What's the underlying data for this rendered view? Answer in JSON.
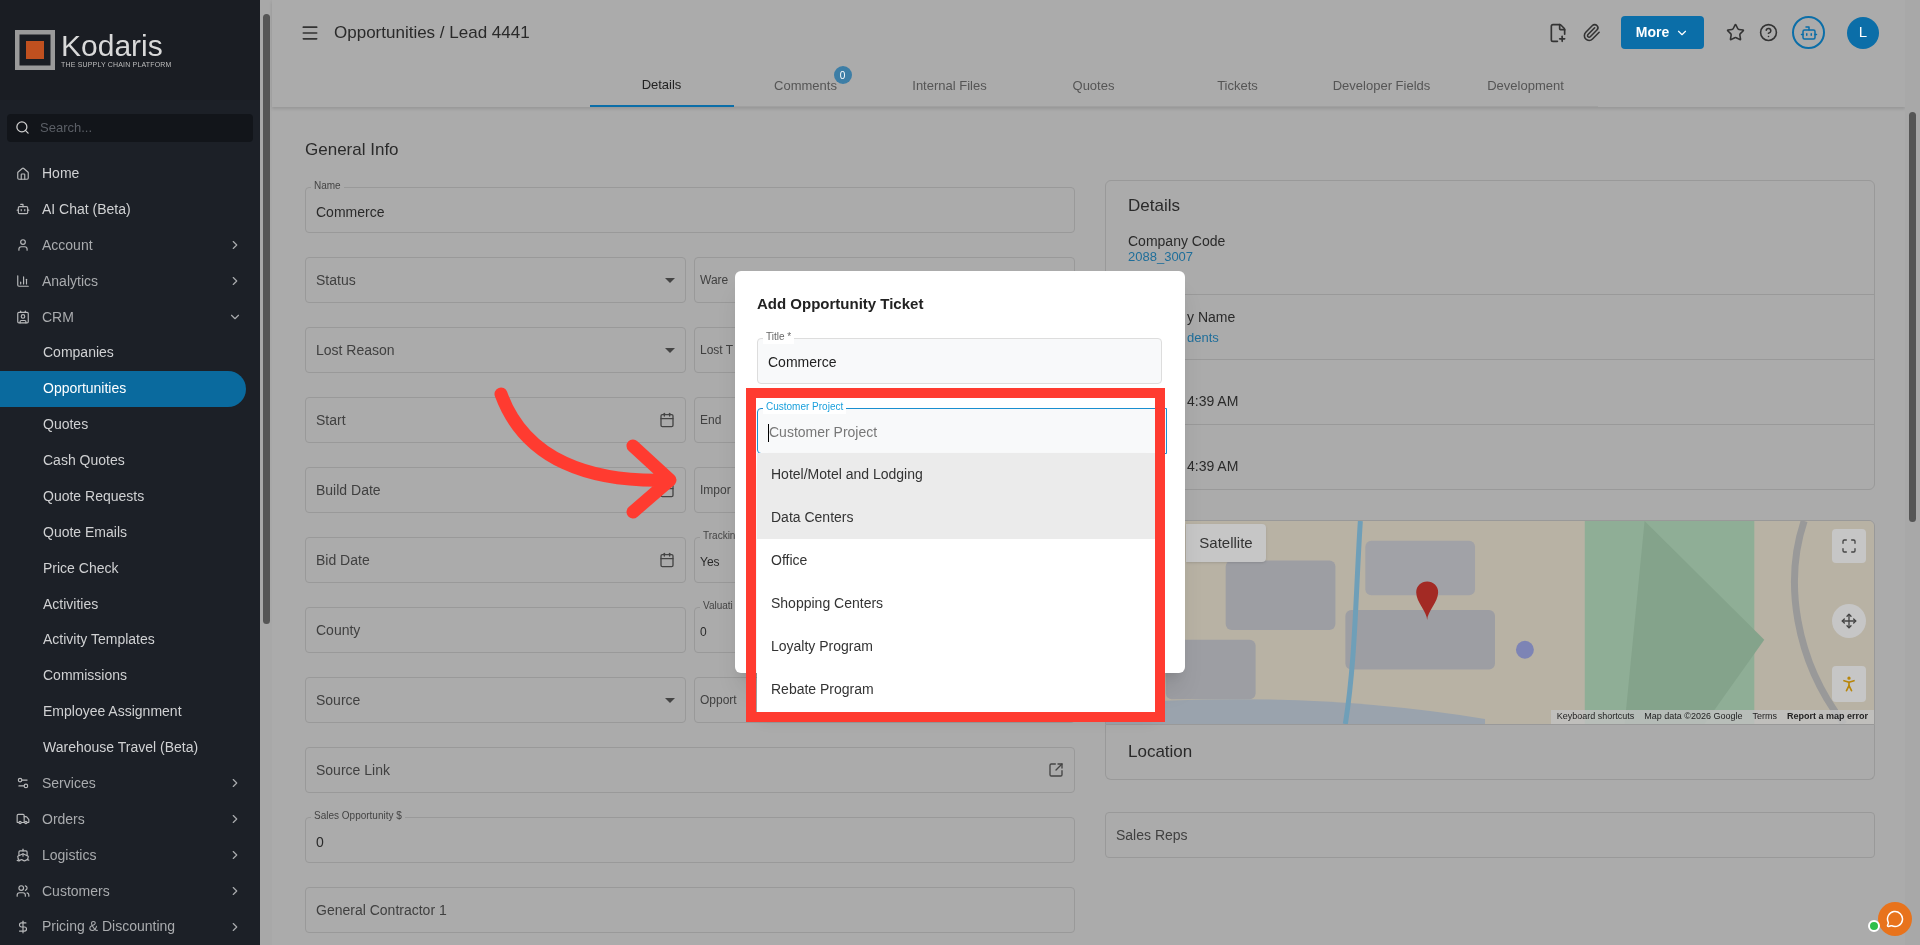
{
  "sidebar": {
    "logo": {
      "name": "Kodaris",
      "tagline": "THE SUPPLY CHAIN PLATFORM"
    },
    "search": {
      "placeholder": "Search..."
    },
    "items": [
      {
        "label": "Home",
        "selected": false
      },
      {
        "label": "AI Chat (Beta)",
        "selected": false
      },
      {
        "label": "Account",
        "selected": false,
        "expanded": false
      },
      {
        "label": "Analytics",
        "selected": false,
        "expanded": false
      },
      {
        "label": "CRM",
        "selected": false,
        "expanded": true,
        "children": [
          {
            "label": "Companies",
            "selected": false
          },
          {
            "label": "Opportunities",
            "selected": true
          },
          {
            "label": "Quotes",
            "selected": false
          },
          {
            "label": "Cash Quotes",
            "selected": false
          },
          {
            "label": "Quote Requests",
            "selected": false
          },
          {
            "label": "Quote Emails",
            "selected": false
          },
          {
            "label": "Price Check",
            "selected": false
          },
          {
            "label": "Activities",
            "selected": false
          },
          {
            "label": "Activity Templates",
            "selected": false
          },
          {
            "label": "Commissions",
            "selected": false
          },
          {
            "label": "Employee Assignment",
            "selected": false
          },
          {
            "label": "Warehouse Travel (Beta)",
            "selected": false
          }
        ]
      },
      {
        "label": "Services",
        "selected": false,
        "expanded": false
      },
      {
        "label": "Orders",
        "selected": false,
        "expanded": false
      },
      {
        "label": "Logistics",
        "selected": false,
        "expanded": false
      },
      {
        "label": "Customers",
        "selected": false,
        "expanded": false
      },
      {
        "label": "Pricing & Discounting",
        "selected": false,
        "expanded": false
      }
    ]
  },
  "header": {
    "breadcrumb": "Opportunities / Lead 4441",
    "more_button": "More",
    "avatar": "L"
  },
  "tabs": [
    {
      "label": "Details",
      "selected": true
    },
    {
      "label": "Comments",
      "selected": false,
      "badge": "0"
    },
    {
      "label": "Internal Files",
      "selected": false
    },
    {
      "label": "Quotes",
      "selected": false
    },
    {
      "label": "Tickets",
      "selected": false
    },
    {
      "label": "Developer Fields",
      "selected": false
    },
    {
      "label": "Development",
      "selected": false
    }
  ],
  "general_info": {
    "title": "General Info",
    "rows": [
      [
        {
          "kind": "text",
          "label": "Name",
          "value": "Commerce"
        }
      ],
      [
        {
          "kind": "select",
          "placeholder": "Status"
        },
        {
          "kind": "text",
          "placeholder": "Ware"
        }
      ],
      [
        {
          "kind": "select",
          "placeholder": "Lost Reason"
        },
        {
          "kind": "text",
          "placeholder": "Lost T"
        }
      ],
      [
        {
          "kind": "date",
          "placeholder": "Start"
        },
        {
          "kind": "text",
          "placeholder": "End"
        }
      ],
      [
        {
          "kind": "date",
          "placeholder": "Build Date"
        },
        {
          "kind": "text",
          "placeholder": "Impor"
        }
      ],
      [
        {
          "kind": "date",
          "placeholder": "Bid Date"
        },
        {
          "kind": "text",
          "label": "Trackin",
          "value": "Yes"
        }
      ],
      [
        {
          "kind": "text",
          "placeholder": "County"
        },
        {
          "kind": "text",
          "label": "Valuati",
          "value": "0"
        }
      ],
      [
        {
          "kind": "select",
          "placeholder": "Source"
        },
        {
          "kind": "text",
          "placeholder": "Opport"
        }
      ],
      [
        {
          "kind": "link",
          "placeholder": "Source Link"
        }
      ],
      [
        {
          "kind": "text",
          "label": "Sales Opportunity $",
          "value": "0"
        }
      ],
      [
        {
          "kind": "text",
          "placeholder": "General Contractor 1"
        }
      ]
    ]
  },
  "details": {
    "title": "Details",
    "rows": [
      {
        "label": "Company Code",
        "value": "2088_3007"
      },
      {
        "label": "y Name",
        "value": "dents"
      },
      {
        "value": "4:39 AM"
      },
      {
        "value": "4:39 AM"
      }
    ]
  },
  "map": {
    "satellite_button": "Satellite",
    "attribution": [
      "Keyboard shortcuts",
      "Map data ©2026 Google",
      "Terms",
      "Report a map error"
    ]
  },
  "location": {
    "title": "Location"
  },
  "sales_reps": {
    "placeholder": "Sales Reps"
  },
  "dialog": {
    "title": "Add Opportunity Ticket",
    "title_field": {
      "label": "Title *",
      "value": "Commerce"
    },
    "project_field": {
      "label": "Customer Project",
      "placeholder": "Customer Project",
      "focused": true
    },
    "options": [
      {
        "label": "Hotel/Motel and Lodging",
        "highlighted": true
      },
      {
        "label": "Data Centers",
        "highlighted": true
      },
      {
        "label": "Office",
        "highlighted": false
      },
      {
        "label": "Shopping Centers",
        "highlighted": false
      },
      {
        "label": "Loyalty Program",
        "highlighted": false
      },
      {
        "label": "Rebate Program",
        "highlighted": false
      }
    ]
  }
}
